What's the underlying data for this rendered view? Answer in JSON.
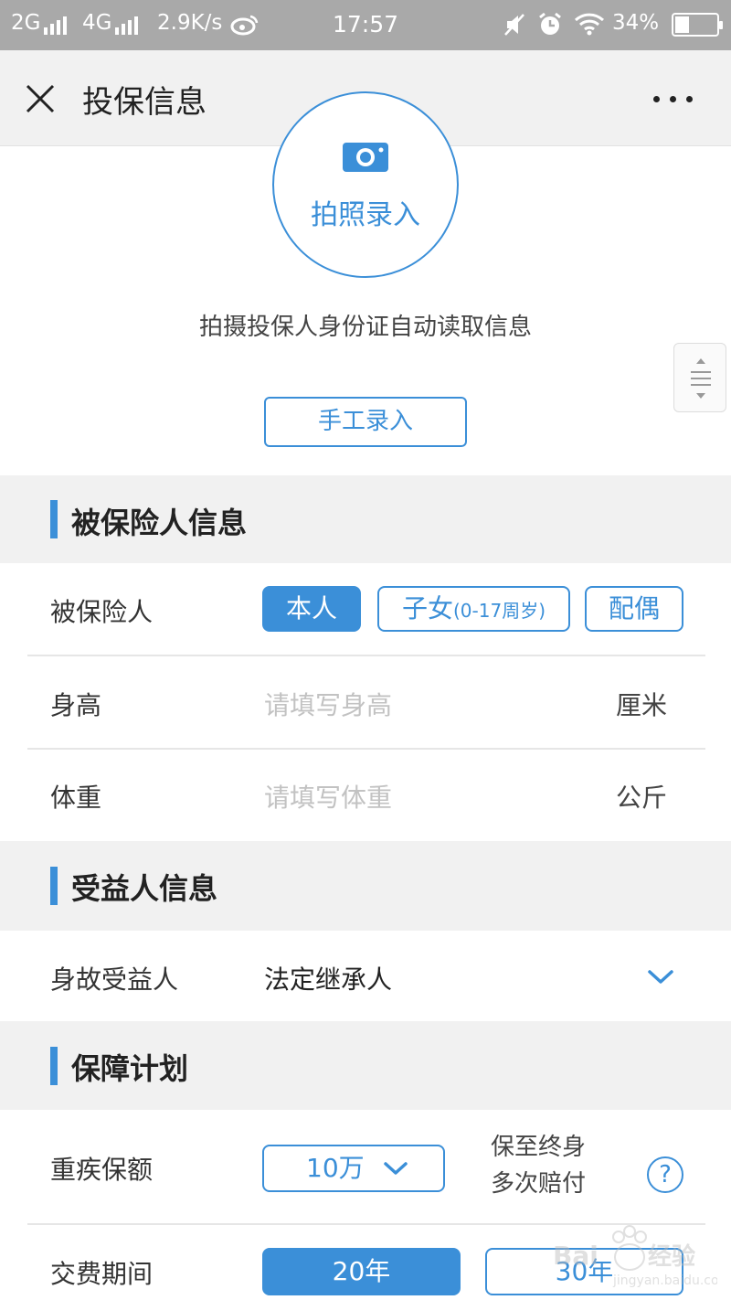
{
  "status_bar": {
    "network1": "2G",
    "network2": "4G",
    "speed": "2.9K/s",
    "time": "17:57",
    "battery_percent": "34%",
    "battery_level": 0.34
  },
  "header": {
    "title": "投保信息"
  },
  "photo_entry": {
    "label": "拍照录入",
    "description": "拍摄投保人身份证自动读取信息",
    "manual_button": "手工录入"
  },
  "insured_section": {
    "title": "被保险人信息",
    "insured_person": {
      "label": "被保险人",
      "options": {
        "self": "本人",
        "child": "子女",
        "child_note": "(0-17周岁)",
        "spouse": "配偶"
      }
    },
    "height": {
      "label": "身高",
      "placeholder": "请填写身高",
      "unit": "厘米"
    },
    "weight": {
      "label": "体重",
      "placeholder": "请填写体重",
      "unit": "公斤"
    }
  },
  "beneficiary_section": {
    "title": "受益人信息",
    "label": "身故受益人",
    "value": "法定继承人"
  },
  "plan_section": {
    "title": "保障计划",
    "coverage": {
      "label": "重疾保额",
      "value": "10万",
      "note_line1": "保至终身",
      "note_line2": "多次赔付"
    },
    "payment_period": {
      "label": "交费期间",
      "option1": "20年",
      "option2": "30年"
    }
  },
  "colors": {
    "accent": "#3b8fd8",
    "section_bg": "#f1f1f1",
    "status_bar_bg": "#a9a9a9"
  },
  "icons": [
    "close-icon",
    "more-icon",
    "camera-icon",
    "chevron-down-icon",
    "help-icon",
    "alarm-icon",
    "wifi-icon",
    "weibo-icon",
    "mute-icon"
  ]
}
